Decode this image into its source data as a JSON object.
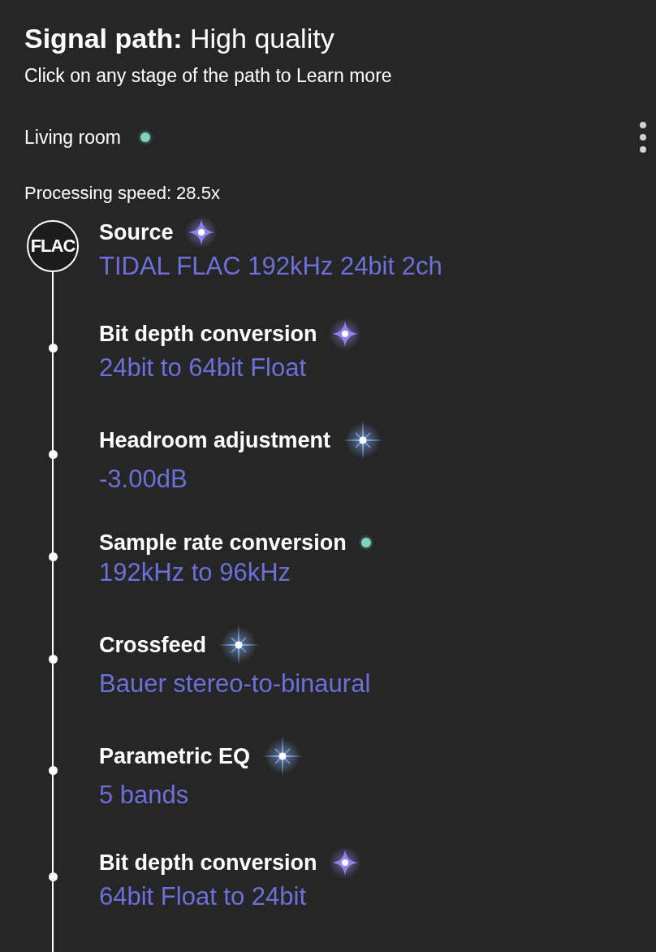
{
  "header": {
    "title": "**Signal path:** High quality",
    "hint": "Click on any stage of the path to Learn more"
  },
  "zone": {
    "name": "Living room",
    "color": "#7fd3c0"
  },
  "processing_speed": "Processing speed: 28.5x",
  "stages": [
    {
      "badge": "FLAC",
      "title": "Source",
      "kind": "sparkle",
      "value": "TIDAL FLAC 192kHz 24bit 2ch"
    },
    {
      "title": "Bit depth conversion",
      "kind": "sparkle",
      "value": "24bit to 64bit Float"
    },
    {
      "title": "Headroom adjustment",
      "kind": "star",
      "value": "-3.00dB"
    },
    {
      "title": "Sample rate conversion",
      "kind": "dot",
      "value": "192kHz to 96kHz"
    },
    {
      "title": "Crossfeed",
      "kind": "star",
      "value": "Bauer stereo-to-binaural"
    },
    {
      "title": "Parametric EQ",
      "kind": "star",
      "value": "5 bands"
    },
    {
      "title": "Bit depth conversion",
      "kind": "sparkle",
      "value": "64bit Float to 24bit"
    }
  ]
}
